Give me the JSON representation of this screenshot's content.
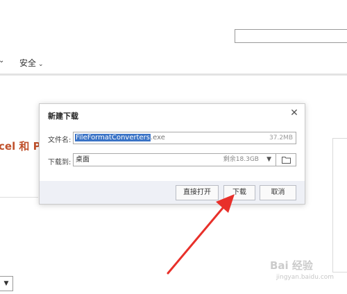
{
  "page": {
    "search_placeholder": "",
    "nav_chevron": "⌄",
    "nav_security_label": "安全",
    "nav_security_arrow": "⌄",
    "headline": "cel 和 Po",
    "dropdown_arrow": "▼",
    "watermark": "Bai 经验",
    "watermark_url": "jingyan.baidu.com"
  },
  "dialog": {
    "title": "新建下载",
    "close_glyph": "✕",
    "filename_label": "文件名:",
    "filename_selected": "FileFormatConverters",
    "filename_ext": ".exe",
    "file_size": "37.2MB",
    "saveto_label": "下载到:",
    "saveto_value": "桌面",
    "remaining_space": "剩余18.3GB",
    "saveto_caret": "▼",
    "folder_icon": "folder-icon",
    "buttons": {
      "open": "直接打开",
      "download": "下载",
      "cancel": "取消"
    }
  },
  "annotation": {
    "arrow_color": "#e8302a"
  }
}
